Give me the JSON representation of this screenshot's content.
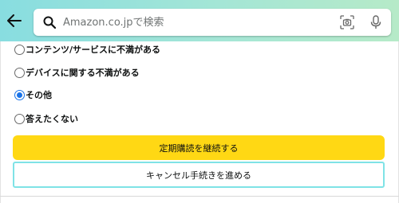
{
  "header": {
    "back_icon": "arrow-left-icon",
    "search": {
      "placeholder": "Amazon.co.jpで検索",
      "value": "",
      "search_icon": "search-icon",
      "camera_icon": "camera-scan-icon",
      "mic_icon": "microphone-icon"
    },
    "gradient_colors": [
      "#88dde0",
      "#b6eac8"
    ]
  },
  "reasons": {
    "options": [
      {
        "label": "コンテンツ/サービスに不満がある",
        "selected": false
      },
      {
        "label": "デバイスに関する不満がある",
        "selected": false
      },
      {
        "label": "その他",
        "selected": true
      },
      {
        "label": "答えたくない",
        "selected": false
      }
    ]
  },
  "actions": {
    "continue_label": "定期購読を継続する",
    "cancel_label": "キャンセル手続きを進める"
  },
  "colors": {
    "primary_button": "#ffd814",
    "secondary_border": "#7fe3e6",
    "radio_selected": "#1a73e8"
  }
}
